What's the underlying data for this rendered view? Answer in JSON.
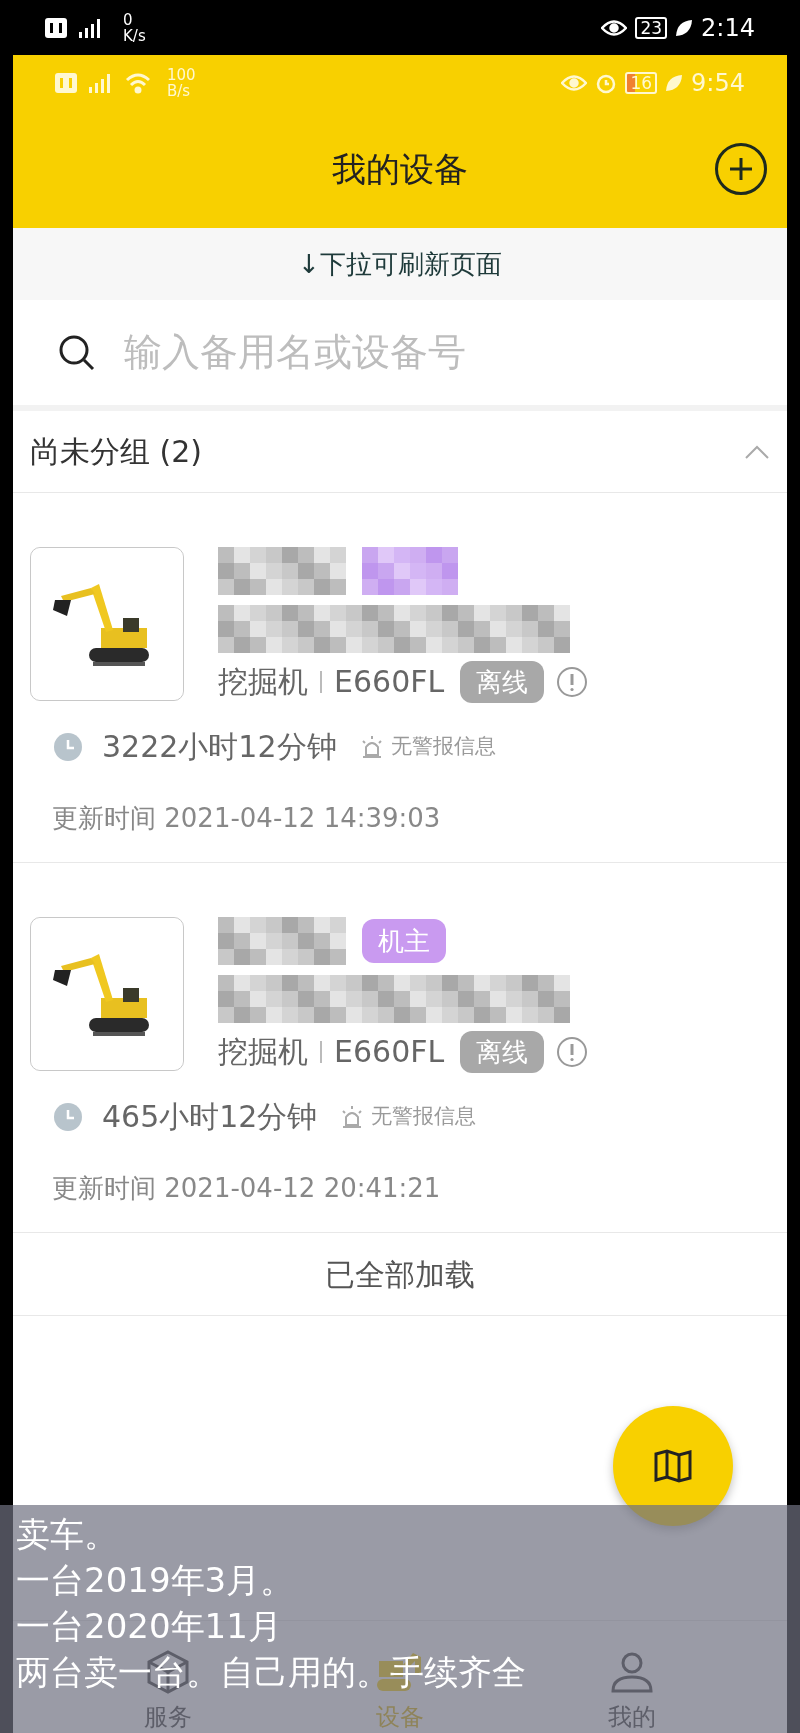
{
  "outer_status_bar": {
    "speed_value": "0",
    "speed_unit": "K/s",
    "battery": "23",
    "time": "2:14"
  },
  "inner_status_bar": {
    "speed_value": "100",
    "speed_unit": "B/s",
    "battery": "16",
    "time": "9:54"
  },
  "header": {
    "title": "我的设备"
  },
  "pull_hint": "↓下拉可刷新页面",
  "search": {
    "placeholder": "输入备用名或设备号"
  },
  "group": {
    "title": "尚未分组 (2)",
    "expanded": true
  },
  "devices": [
    {
      "type": "挖掘机",
      "model": "E660FL",
      "status": "离线",
      "runtime": "3222小时12分钟",
      "alarm": "无警报信息",
      "updated": "更新时间 2021-04-12 14:39:03"
    },
    {
      "role": "机主",
      "type": "挖掘机",
      "model": "E660FL",
      "status": "离线",
      "runtime": "465小时12分钟",
      "alarm": "无警报信息",
      "updated": "更新时间 2021-04-12 20:41:21"
    }
  ],
  "footer": "已全部加载",
  "nav": [
    {
      "label": "服务",
      "selected": false,
      "kind": "box"
    },
    {
      "label": "设备",
      "selected": true,
      "kind": "excavator"
    },
    {
      "label": "我的",
      "selected": false,
      "kind": "person"
    }
  ],
  "caption": [
    "卖车。",
    "一台2019年3月。",
    "一台2020年11月",
    "两台卖一台。自己用的。手续齐全"
  ]
}
